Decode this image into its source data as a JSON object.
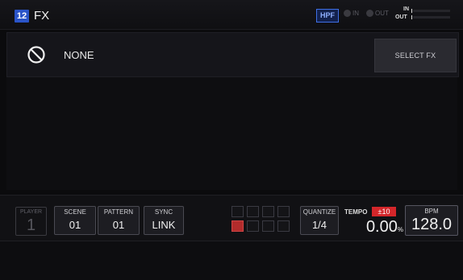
{
  "header": {
    "channel": "12",
    "title": "FX",
    "hpf_label": "HPF",
    "in_label": "IN",
    "out_label": "OUT",
    "meter_in_label": "IN",
    "meter_out_label": "OUT"
  },
  "fx": {
    "none_icon": "prohibited-icon",
    "current_label": "NONE",
    "select_label": "SELECT FX"
  },
  "controls": {
    "player": {
      "label": "PLAYER",
      "value": "1"
    },
    "scene": {
      "label": "SCENE",
      "value": "01"
    },
    "pattern": {
      "label": "PATTERN",
      "value": "01"
    },
    "sync": {
      "label": "SYNC",
      "value": "LINK"
    },
    "quantize": {
      "label": "QUANTIZE",
      "value": "1/4"
    },
    "tempo": {
      "label": "TEMPO",
      "range": "±10",
      "value": "0.00",
      "unit": "%"
    },
    "bpm": {
      "label": "BPM",
      "value": "128.0"
    },
    "step_pads": {
      "rows": 2,
      "cols": 4,
      "active_index": 4
    }
  },
  "colors": {
    "accent_blue": "#2a54c8",
    "tempo_red": "#d4262a",
    "active_pad": "#b22c2c"
  }
}
